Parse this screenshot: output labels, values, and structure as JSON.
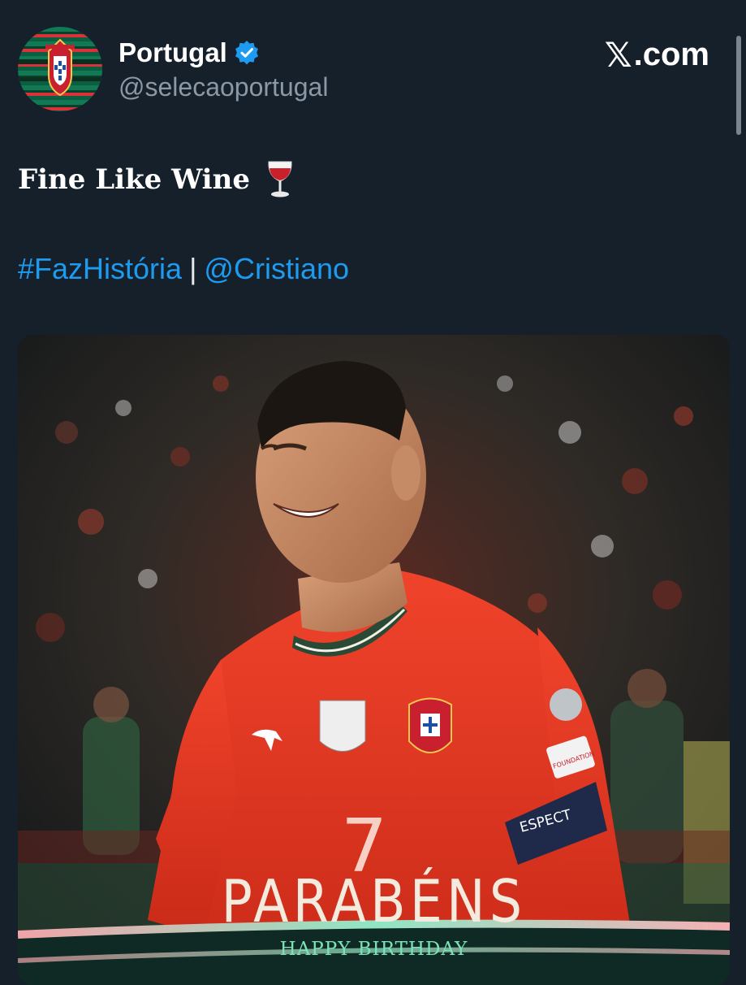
{
  "header": {
    "display_name": "Portugal",
    "handle": "@selecaoportugal",
    "brand_text": ".com",
    "brand_mark": "𝕏",
    "verified_icon": "verified-badge-icon",
    "verified_color": "#1d9bf0"
  },
  "tweet": {
    "line1": "Fine Like Wine",
    "line1_emoji": "wine-glass-icon",
    "hashtag": "#FazHistória",
    "separator": "|",
    "mention": "@Cristiano",
    "link_color": "#1d9bf0"
  },
  "media": {
    "title": "PARABÉNS",
    "subtitle": "HAPPY BIRTHDAY",
    "shirt_number": "7",
    "armband_text": "ESPECT",
    "sleeve_badge_text": "FOUNDATION",
    "accent_green": "#7be3b8",
    "shirt_red": "#e5341f"
  }
}
